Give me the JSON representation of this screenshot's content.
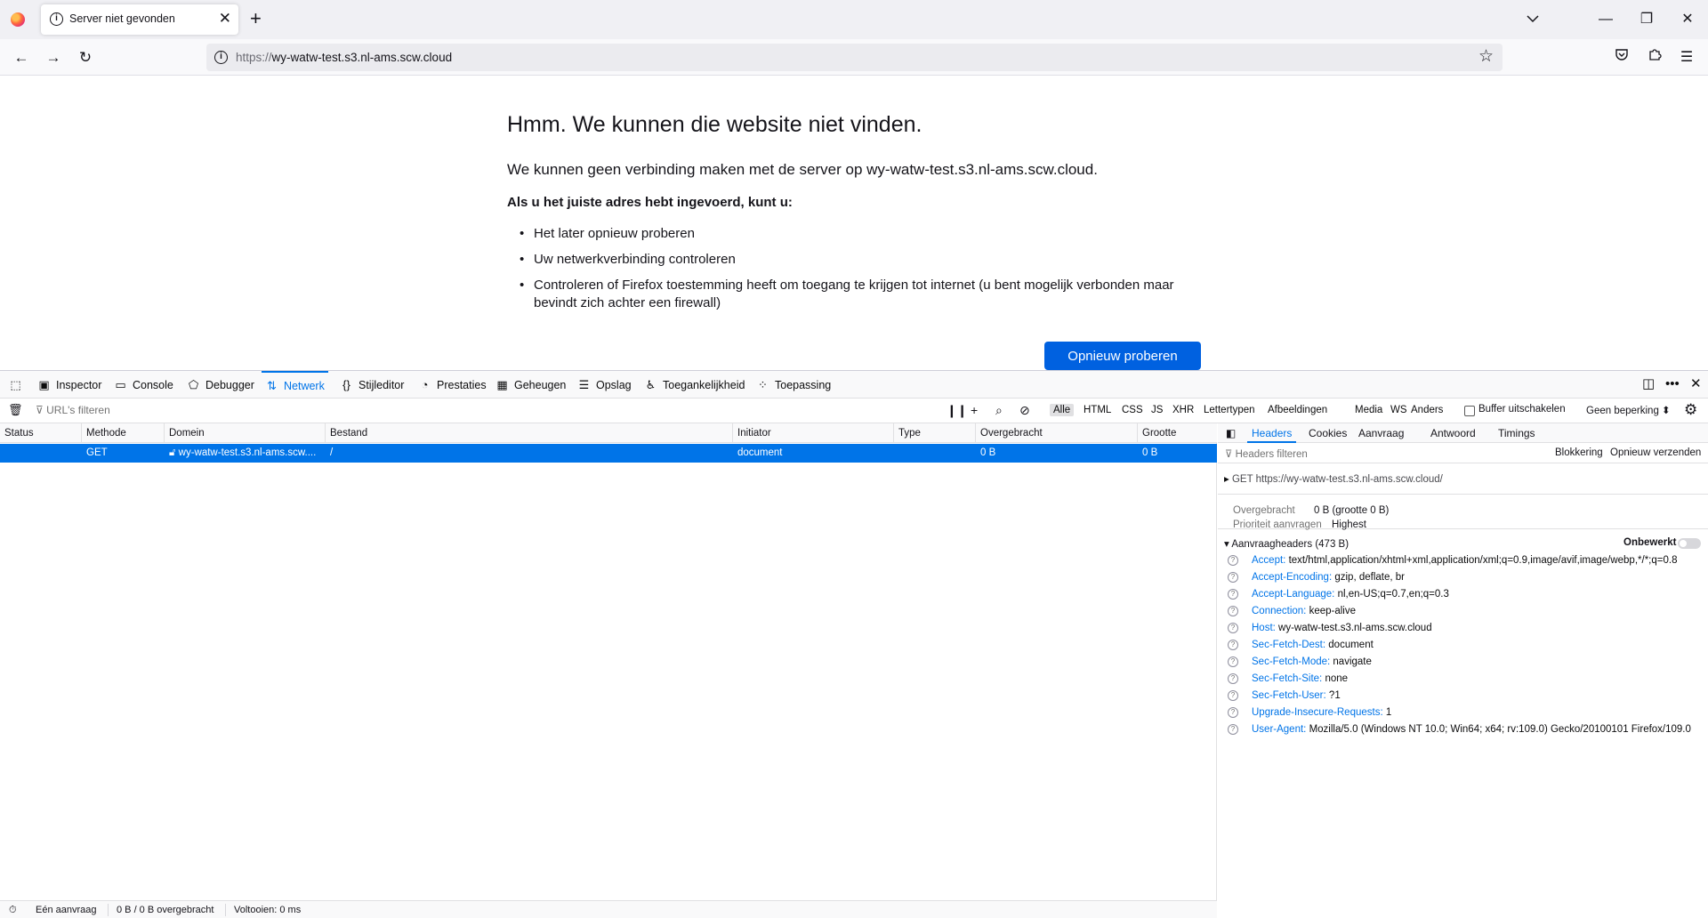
{
  "browser": {
    "tab_title": "Server niet gevonden",
    "url_protocol": "https://",
    "url_host": "wy-watw-test.s3.nl-ams.scw.cloud"
  },
  "error_page": {
    "title": "Hmm. We kunnen die website niet vinden.",
    "description": "We kunnen geen verbinding maken met de server op wy-watw-test.s3.nl-ams.scw.cloud.",
    "subtitle": "Als u het juiste adres hebt ingevoerd, kunt u:",
    "suggestions": [
      "Het later opnieuw proberen",
      "Uw netwerkverbinding controleren",
      "Controleren of Firefox toestemming heeft om toegang te krijgen tot internet (u bent mogelijk verbonden maar bevindt zich achter een firewall)"
    ],
    "retry_label": "Opnieuw proberen",
    "retry_color": "#0061e0"
  },
  "devtools": {
    "tabs": [
      "Inspector",
      "Console",
      "Debugger",
      "Netwerk",
      "Stijleditor",
      "Prestaties",
      "Geheugen",
      "Opslag",
      "Toegankelijkheid",
      "Toepassing"
    ],
    "active_tab": "Netwerk",
    "accent": "#0074e8",
    "url_filter_placeholder": "URL's filteren",
    "type_filters": [
      "Alle",
      "HTML",
      "CSS",
      "JS",
      "XHR",
      "Lettertypen",
      "Afbeeldingen",
      "Media",
      "WS",
      "Anders"
    ],
    "active_type_filter": "Alle",
    "disable_cache_label": "Buffer uitschakelen",
    "throttle_label": "Geen beperking ⬍",
    "columns": [
      "Status",
      "Methode",
      "Domein",
      "Bestand",
      "Initiator",
      "Type",
      "Overgebracht",
      "Grootte"
    ],
    "requests": [
      {
        "status": "",
        "method": "GET",
        "domain": "wy-watw-test.s3.nl-ams.scw....",
        "file": "/",
        "initiator": "document",
        "type": "",
        "transferred": "0 B",
        "size": "0 B"
      }
    ],
    "side_tabs": [
      "Headers",
      "Cookies",
      "Aanvraag",
      "Antwoord",
      "Timings"
    ],
    "active_side_tab": "Headers",
    "headers_filter_placeholder": "Headers filteren",
    "blocking_label": "Blokkering",
    "resend_label": "Opnieuw verzenden",
    "general": {
      "method": "GET",
      "url": "https://wy-watw-test.s3.nl-ams.scw.cloud/"
    },
    "summary": {
      "transferred_key": "Overgebracht",
      "transferred_value": "0 B (grootte 0 B)",
      "priority_key": "Prioriteit aanvragen",
      "priority_value": "Highest"
    },
    "request_headers_title": "Aanvraagheaders (473 B)",
    "raw_label": "Onbewerkt",
    "request_headers": [
      {
        "name": "Accept:",
        "value": "text/html,application/xhtml+xml,application/xml;q=0.9,image/avif,image/webp,*/*;q=0.8"
      },
      {
        "name": "Accept-Encoding:",
        "value": "gzip, deflate, br"
      },
      {
        "name": "Accept-Language:",
        "value": "nl,en-US;q=0.7,en;q=0.3"
      },
      {
        "name": "Connection:",
        "value": "keep-alive"
      },
      {
        "name": "Host:",
        "value": "wy-watw-test.s3.nl-ams.scw.cloud"
      },
      {
        "name": "Sec-Fetch-Dest:",
        "value": "document"
      },
      {
        "name": "Sec-Fetch-Mode:",
        "value": "navigate"
      },
      {
        "name": "Sec-Fetch-Site:",
        "value": "none"
      },
      {
        "name": "Sec-Fetch-User:",
        "value": "?1"
      },
      {
        "name": "Upgrade-Insecure-Requests:",
        "value": "1"
      },
      {
        "name": "User-Agent:",
        "value": "Mozilla/5.0 (Windows NT 10.0; Win64; x64; rv:109.0) Gecko/20100101 Firefox/109.0"
      }
    ],
    "status_bar": {
      "requests": "Eén aanvraag",
      "transferred": "0 B / 0 B overgebracht",
      "finish": "Voltooien: 0 ms"
    }
  }
}
